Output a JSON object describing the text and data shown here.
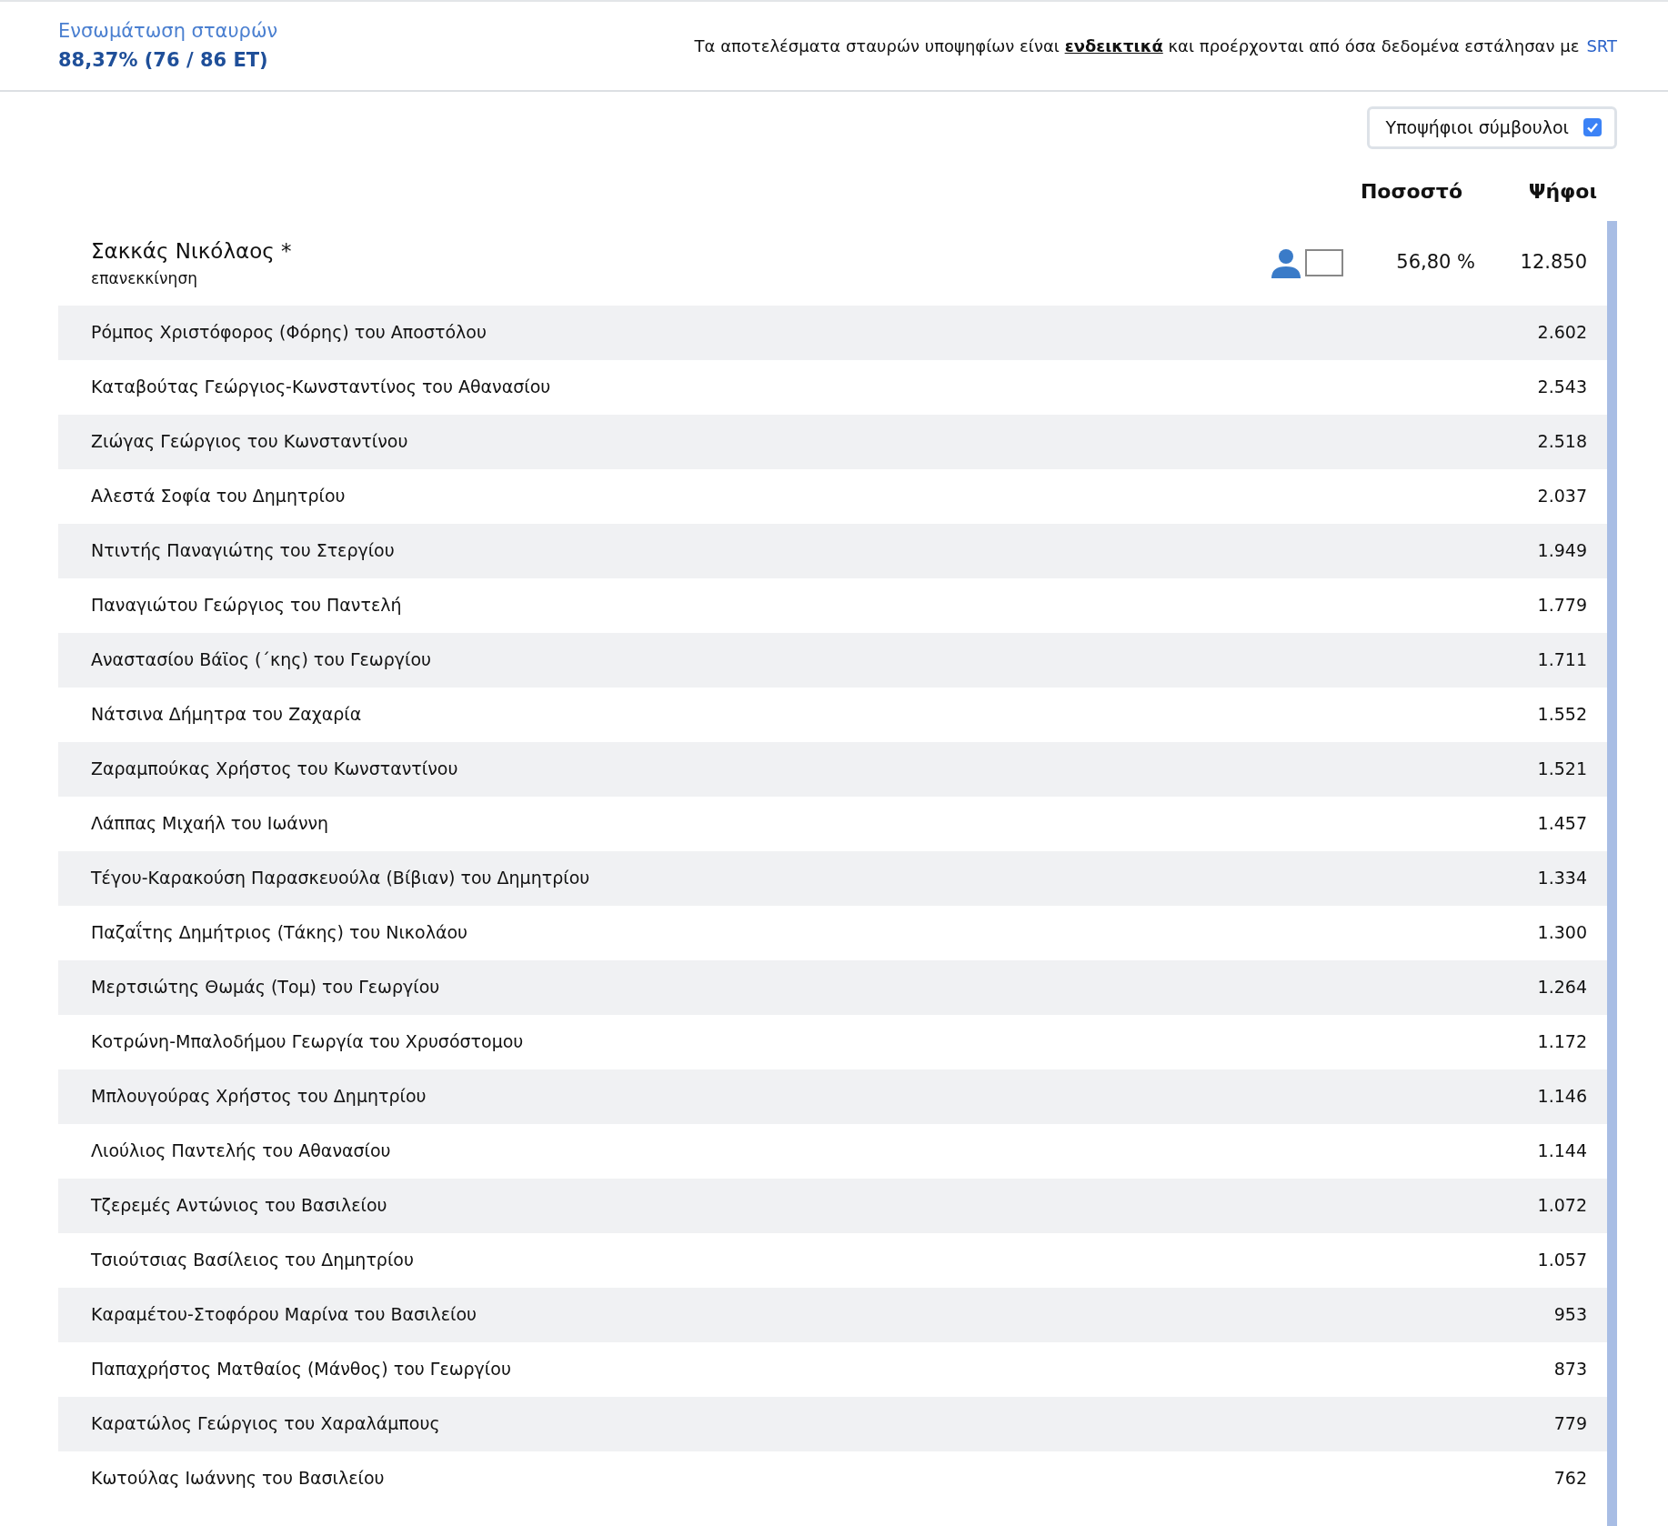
{
  "header": {
    "title": "Ενσωμάτωση σταυρών",
    "value": "88,37% (76 / 86 ΕΤ)",
    "notice": "Τα αποτελέσματα σταυρών υποψηφίων είναι **ενδεικτικά** και προέρχονται από όσα δεδομένα εστάλησαν με",
    "notice_link": "SRT"
  },
  "toggle": {
    "label": "Υποψήφιοι σύμβουλοι",
    "checked": true
  },
  "columns": [
    "Ποσοστό",
    "Ψήφοι"
  ],
  "leader": {
    "name": "Σακκάς Νικόλαος",
    "mark": "*",
    "subtitle": "επανεκκίνηση",
    "percent": "56,80 %",
    "votes": "12.850",
    "selected": false
  },
  "rows": [
    {
      "name": "Ρόμπος Χριστόφορος (Φόρης) του Αποστόλου",
      "votes": "2.602"
    },
    {
      "name": "Καταβούτας Γεώργιος-Κωνσταντίνος του Αθανασίου",
      "votes": "2.543"
    },
    {
      "name": "Ζιώγας Γεώργιος του Κωνσταντίνου",
      "votes": "2.518"
    },
    {
      "name": "Αλεστά Σοφία του Δημητρίου",
      "votes": "2.037"
    },
    {
      "name": "Ντιντής Παναγιώτης του Στεργίου",
      "votes": "1.949"
    },
    {
      "name": "Παναγιώτου Γεώργιος του Παντελή",
      "votes": "1.779"
    },
    {
      "name": "Αναστασίου Βάϊος (΄κης) του Γεωργίου",
      "votes": "1.711"
    },
    {
      "name": "Νάτσινα Δήμητρα του Ζαχαρία",
      "votes": "1.552"
    },
    {
      "name": "Ζαραμπούκας Χρήστος του Κωνσταντίνου",
      "votes": "1.521"
    },
    {
      "name": "Λάππας Μιχαήλ του Ιωάννη",
      "votes": "1.457"
    },
    {
      "name": "Τέγου-Καρακούση Παρασκευούλα (Βίβιαν) του Δημητρίου",
      "votes": "1.334"
    },
    {
      "name": "Παζαΐτης Δημήτριος (Τάκης) του Νικολάου",
      "votes": "1.300"
    },
    {
      "name": "Μερτσιώτης Θωμάς (Τομ) του Γεωργίου",
      "votes": "1.264"
    },
    {
      "name": "Κοτρώνη-Μπαλοδήμου Γεωργία του Χρυσόστομου",
      "votes": "1.172"
    },
    {
      "name": "Μπλουγούρας Χρήστος του Δημητρίου",
      "votes": "1.146"
    },
    {
      "name": "Λιούλιος Παντελής του Αθανασίου",
      "votes": "1.144"
    },
    {
      "name": "Τζερεμές Αντώνιος του Βασιλείου",
      "votes": "1.072"
    },
    {
      "name": "Τσιούτσιας Βασίλειος του Δημητρίου",
      "votes": "1.057"
    },
    {
      "name": "Καραμέτου-Στοφόρου Μαρίνα του Βασιλείου",
      "votes": "953"
    },
    {
      "name": "Παπαχρήστος Ματθαίος (Μάνθος) του Γεωργίου",
      "votes": "873"
    },
    {
      "name": "Καρατώλος Γεώργιος του Χαραλάμπους",
      "votes": "779"
    },
    {
      "name": "Κωτούλας Ιωάννης του Βασιλείου",
      "votes": "762"
    }
  ]
}
